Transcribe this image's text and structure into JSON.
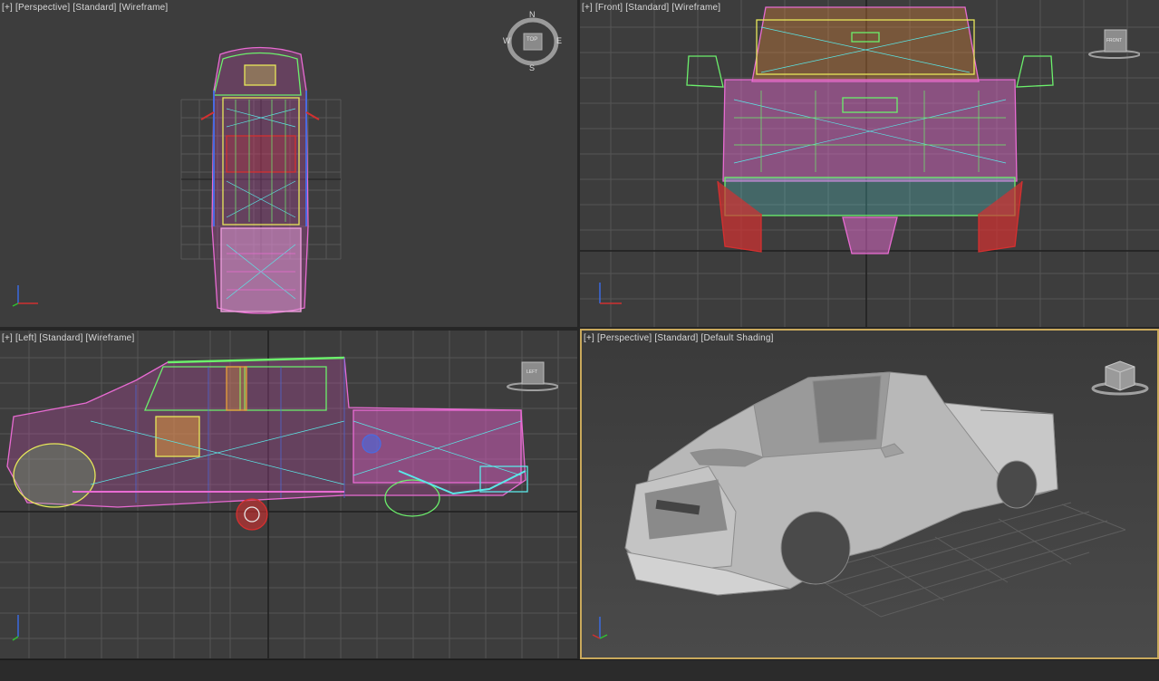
{
  "viewports": {
    "top": {
      "label_plus": "[+]",
      "label_view": "[Perspective]",
      "label_mode": "[Standard]",
      "label_shading": "[Wireframe]"
    },
    "front": {
      "label_plus": "[+]",
      "label_view": "[Front]",
      "label_mode": "[Standard]",
      "label_shading": "[Wireframe]"
    },
    "left": {
      "label_plus": "[+]",
      "label_view": "[Left]",
      "label_mode": "[Standard]",
      "label_shading": "[Wireframe]"
    },
    "perspective": {
      "label_plus": "[+]",
      "label_view": "[Perspective]",
      "label_mode": "[Standard]",
      "label_shading": "[Default Shading]"
    }
  },
  "viewcube": {
    "compass_n": "N",
    "compass_s": "S",
    "compass_e": "E",
    "compass_w": "W",
    "top_face": "TOP",
    "front_face": "FRONT",
    "left_face": "LEFT"
  },
  "colors": {
    "viewport_bg": "#3d3d3d",
    "active_border": "#c9a95c",
    "grid": "#575757",
    "grid_axis": "#1e1e1e",
    "wire_pink": "#e86bd2",
    "wire_green": "#6cf06c",
    "wire_yellow": "#e8e85a",
    "wire_cyan": "#5ae8e8",
    "wire_red": "#d43030",
    "wire_blue": "#4a6ae0",
    "wire_orange": "#f0903a",
    "shaded_body": "#bdbdbd"
  },
  "icons": [
    "axis-tripod-icon",
    "viewcube-icon",
    "compass-ring-icon"
  ]
}
